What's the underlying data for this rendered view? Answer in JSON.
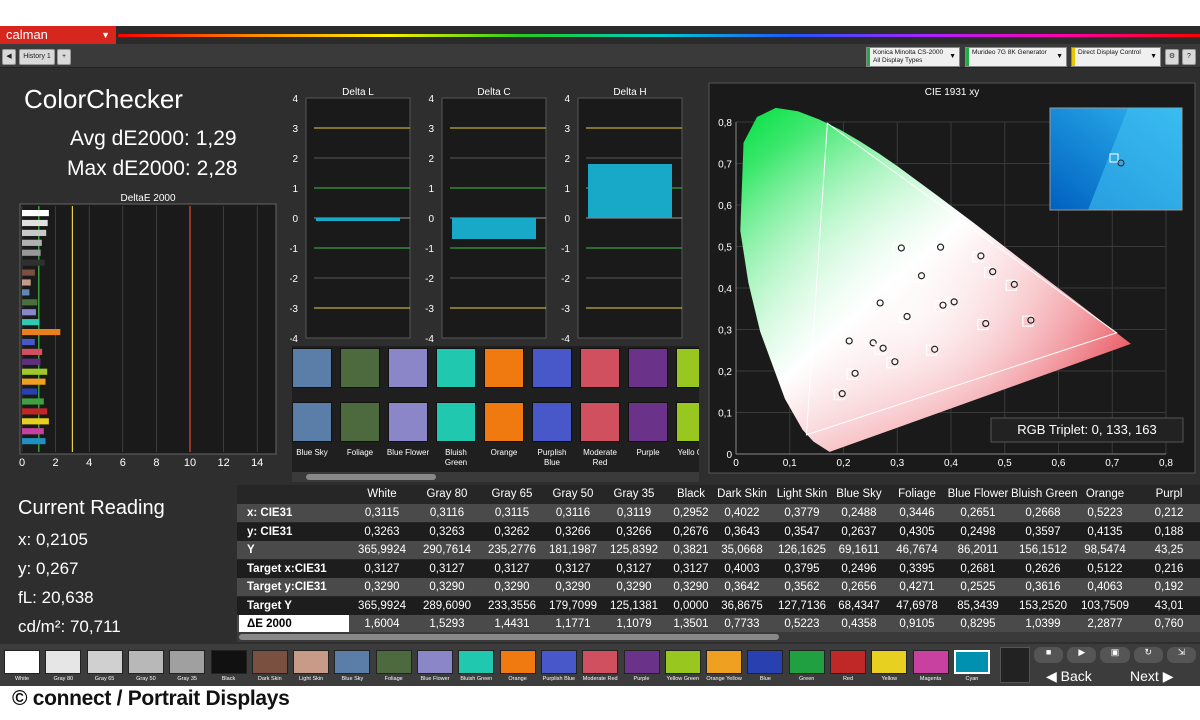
{
  "app": {
    "logo": "calman",
    "tab": "History 1"
  },
  "devices": [
    {
      "line1": "Konica Minolta CS-2000",
      "line2": "All Display Types",
      "color": "#22aa44"
    },
    {
      "line1": "Murideo 7G 8K Generator",
      "line2": "",
      "color": "#22aa44"
    },
    {
      "line1": "Direct Display Control",
      "line2": "",
      "color": "#e8c800"
    }
  ],
  "summary": {
    "title": "ColorChecker",
    "avg": "Avg dE2000: 1,29",
    "max": "Max dE2000: 2,28"
  },
  "reading": {
    "heading": "Current Reading",
    "x": "x: 0,2105",
    "y": "y: 0,267",
    "fl": "fL: 20,638",
    "cd": "cd/m²: 70,711"
  },
  "deltae_chart": {
    "title": "DeltaE 2000",
    "ticks": [
      "0",
      "2",
      "4",
      "6",
      "8",
      "10",
      "12",
      "14"
    ],
    "bars": [
      {
        "color": "#ffffff",
        "value": 1.6
      },
      {
        "color": "#e0e0e0",
        "value": 1.53
      },
      {
        "color": "#c8c8c8",
        "value": 1.44
      },
      {
        "color": "#b0b0b0",
        "value": 1.18
      },
      {
        "color": "#989898",
        "value": 1.11
      },
      {
        "color": "#303030",
        "value": 1.35
      },
      {
        "color": "#7a5040",
        "value": 0.77
      },
      {
        "color": "#c89a88",
        "value": 0.52
      },
      {
        "color": "#6088b0",
        "value": 0.44
      },
      {
        "color": "#4a7040",
        "value": 0.91
      },
      {
        "color": "#8888cc",
        "value": 0.83
      },
      {
        "color": "#30c8b0",
        "value": 1.04
      },
      {
        "color": "#e88020",
        "value": 2.28
      },
      {
        "color": "#4858c8",
        "value": 0.76
      },
      {
        "color": "#d05060",
        "value": 1.2
      },
      {
        "color": "#603080",
        "value": 1.1
      },
      {
        "color": "#a0c828",
        "value": 1.5
      },
      {
        "color": "#f0a020",
        "value": 1.4
      },
      {
        "color": "#2840b0",
        "value": 0.9
      },
      {
        "color": "#40a040",
        "value": 1.3
      },
      {
        "color": "#c02828",
        "value": 1.5
      },
      {
        "color": "#e8d020",
        "value": 1.6
      },
      {
        "color": "#c840a0",
        "value": 1.3
      },
      {
        "color": "#2090c0",
        "value": 1.4
      }
    ]
  },
  "delta_charts": [
    {
      "title": "Delta L",
      "value": -0.1
    },
    {
      "title": "Delta C",
      "value": -0.7
    },
    {
      "title": "Delta H",
      "value": 1.8
    }
  ],
  "delta_ticks": [
    "4",
    "3",
    "2",
    "1",
    "0",
    "-1",
    "-2",
    "-3",
    "-4"
  ],
  "cie": {
    "title": "CIE 1931 xy",
    "xticks": [
      "0",
      "0,1",
      "0,2",
      "0,3",
      "0,4",
      "0,5",
      "0,6",
      "0,7",
      "0,8"
    ],
    "yticks": [
      "0,8",
      "0,7",
      "0,6",
      "0,5",
      "0,4",
      "0,3",
      "0,2",
      "0,1",
      "0"
    ],
    "triplet": "RGB Triplet: 0, 133, 163",
    "points": [
      {
        "x": 0.3127,
        "y": 0.329
      },
      {
        "x": 0.4003,
        "y": 0.3642
      },
      {
        "x": 0.3795,
        "y": 0.3562
      },
      {
        "x": 0.2496,
        "y": 0.2656
      },
      {
        "x": 0.3395,
        "y": 0.4271
      },
      {
        "x": 0.2681,
        "y": 0.2525
      },
      {
        "x": 0.2626,
        "y": 0.3616
      },
      {
        "x": 0.5122,
        "y": 0.4063
      },
      {
        "x": 0.216,
        "y": 0.192
      },
      {
        "x": 0.459,
        "y": 0.312
      },
      {
        "x": 0.29,
        "y": 0.22
      },
      {
        "x": 0.375,
        "y": 0.496
      },
      {
        "x": 0.472,
        "y": 0.437
      },
      {
        "x": 0.192,
        "y": 0.143
      },
      {
        "x": 0.302,
        "y": 0.494
      },
      {
        "x": 0.543,
        "y": 0.32
      },
      {
        "x": 0.45,
        "y": 0.475
      },
      {
        "x": 0.364,
        "y": 0.25
      },
      {
        "x": 0.205,
        "y": 0.27
      }
    ]
  },
  "swatches": [
    {
      "label": "Blue Sky",
      "color": "#5a7ea8"
    },
    {
      "label": "Foliage",
      "color": "#4d6a3e"
    },
    {
      "label": "Blue Flower",
      "color": "#8a86c8"
    },
    {
      "label": "Bluish Green",
      "color": "#20c8b0"
    },
    {
      "label": "Orange",
      "color": "#f07a10"
    },
    {
      "label": "Purplish Blue",
      "color": "#4858c8"
    },
    {
      "label": "Moderate Red",
      "color": "#d05060"
    },
    {
      "label": "Purple",
      "color": "#6a3288"
    },
    {
      "label": "Yello Gree",
      "color": "#98c820"
    }
  ],
  "table": {
    "headers": [
      "White",
      "Gray 80",
      "Gray 65",
      "Gray 50",
      "Gray 35",
      "Black",
      "Dark Skin",
      "Light Skin",
      "Blue Sky",
      "Foliage",
      "Blue Flower",
      "Bluish Green",
      "Orange",
      "Purpl"
    ],
    "rows": [
      {
        "label": "x: CIE31",
        "values": [
          "0,3115",
          "0,3116",
          "0,3115",
          "0,3116",
          "0,3119",
          "0,2952",
          "0,4022",
          "0,3779",
          "0,2488",
          "0,3446",
          "0,2651",
          "0,2668",
          "0,5223",
          "0,212"
        ]
      },
      {
        "label": "y: CIE31",
        "values": [
          "0,3263",
          "0,3263",
          "0,3262",
          "0,3266",
          "0,3266",
          "0,2676",
          "0,3643",
          "0,3547",
          "0,2637",
          "0,4305",
          "0,2498",
          "0,3597",
          "0,4135",
          "0,188"
        ]
      },
      {
        "label": "Y",
        "values": [
          "365,9924",
          "290,7614",
          "235,2776",
          "181,1987",
          "125,8392",
          "0,3821",
          "35,0668",
          "126,1625",
          "69,1611",
          "46,7674",
          "86,2011",
          "156,1512",
          "98,5474",
          "43,25"
        ]
      },
      {
        "label": "Target x:CIE31",
        "values": [
          "0,3127",
          "0,3127",
          "0,3127",
          "0,3127",
          "0,3127",
          "0,3127",
          "0,4003",
          "0,3795",
          "0,2496",
          "0,3395",
          "0,2681",
          "0,2626",
          "0,5122",
          "0,216"
        ]
      },
      {
        "label": "Target y:CIE31",
        "values": [
          "0,3290",
          "0,3290",
          "0,3290",
          "0,3290",
          "0,3290",
          "0,3290",
          "0,3642",
          "0,3562",
          "0,2656",
          "0,4271",
          "0,2525",
          "0,3616",
          "0,4063",
          "0,192"
        ]
      },
      {
        "label": "Target Y",
        "values": [
          "365,9924",
          "289,6090",
          "233,3556",
          "179,7099",
          "125,1381",
          "0,0000",
          "36,8675",
          "127,7136",
          "68,4347",
          "47,6978",
          "85,3439",
          "153,2520",
          "103,7509",
          "43,01"
        ]
      },
      {
        "label": "ΔE 2000",
        "values": [
          "1,6004",
          "1,5293",
          "1,4431",
          "1,1771",
          "1,1079",
          "1,3501",
          "0,7733",
          "0,5223",
          "0,4358",
          "0,9105",
          "0,8295",
          "1,0399",
          "2,2877",
          "0,760"
        ]
      }
    ]
  },
  "bottom_swatches": [
    {
      "label": "White",
      "color": "#ffffff"
    },
    {
      "label": "Gray 80",
      "color": "#e6e6e6"
    },
    {
      "label": "Gray 65",
      "color": "#d0d0d0"
    },
    {
      "label": "Gray 50",
      "color": "#b8b8b8"
    },
    {
      "label": "Gray 35",
      "color": "#a0a0a0"
    },
    {
      "label": "Black",
      "color": "#111111"
    },
    {
      "label": "Dark Skin",
      "color": "#7a5040"
    },
    {
      "label": "Light Skin",
      "color": "#c89a88"
    },
    {
      "label": "Blue Sky",
      "color": "#5a7ea8"
    },
    {
      "label": "Foliage",
      "color": "#4d6a3e"
    },
    {
      "label": "Blue Flower",
      "color": "#8a86c8"
    },
    {
      "label": "Bluish Green",
      "color": "#20c8b0"
    },
    {
      "label": "Orange",
      "color": "#f07a10"
    },
    {
      "label": "Purplish Blue",
      "color": "#4858c8"
    },
    {
      "label": "Moderate Red",
      "color": "#d05060"
    },
    {
      "label": "Purple",
      "color": "#6a3288"
    },
    {
      "label": "Yellow Green",
      "color": "#98c820"
    },
    {
      "label": "Orange Yellow",
      "color": "#f0a020"
    },
    {
      "label": "Blue",
      "color": "#2840b0"
    },
    {
      "label": "Green",
      "color": "#20a040"
    },
    {
      "label": "Red",
      "color": "#c02828"
    },
    {
      "label": "Yellow",
      "color": "#e8d020"
    },
    {
      "label": "Magenta",
      "color": "#c840a0"
    },
    {
      "label": "Cyan",
      "color": "#0090b0"
    }
  ],
  "nav": {
    "back": "Back",
    "next": "Next"
  },
  "credit": "© connect / Portrait Displays"
}
